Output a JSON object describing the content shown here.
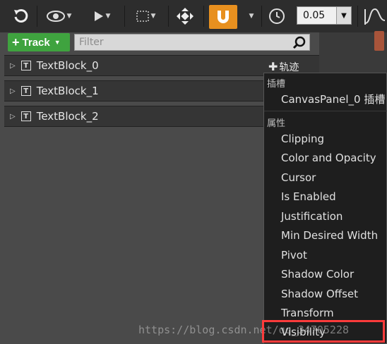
{
  "toolbar": {
    "snap_interval": "0.05"
  },
  "track_button": {
    "plus": "+",
    "label": "Track"
  },
  "filter": {
    "placeholder": "Filter"
  },
  "tracks": [
    {
      "name": "TextBlock_0",
      "add_label": "轨迹"
    },
    {
      "name": "TextBlock_1"
    },
    {
      "name": "TextBlock_2"
    }
  ],
  "menu": {
    "section_slot": "插槽",
    "slot_item": "CanvasPanel_0 插槽",
    "section_properties": "属性",
    "items": [
      "Clipping",
      "Color and Opacity",
      "Cursor",
      "Is Enabled",
      "Justification",
      "Min Desired Width",
      "Pivot",
      "Shadow Color",
      "Shadow Offset",
      "Transform",
      "Visibility"
    ]
  },
  "watermark": "https://blog.csdn.net/qq_34705228",
  "colors": {
    "accent_green": "#3fa33f",
    "magnet_orange": "#e8901f",
    "highlight_red": "#ff3b3b"
  }
}
